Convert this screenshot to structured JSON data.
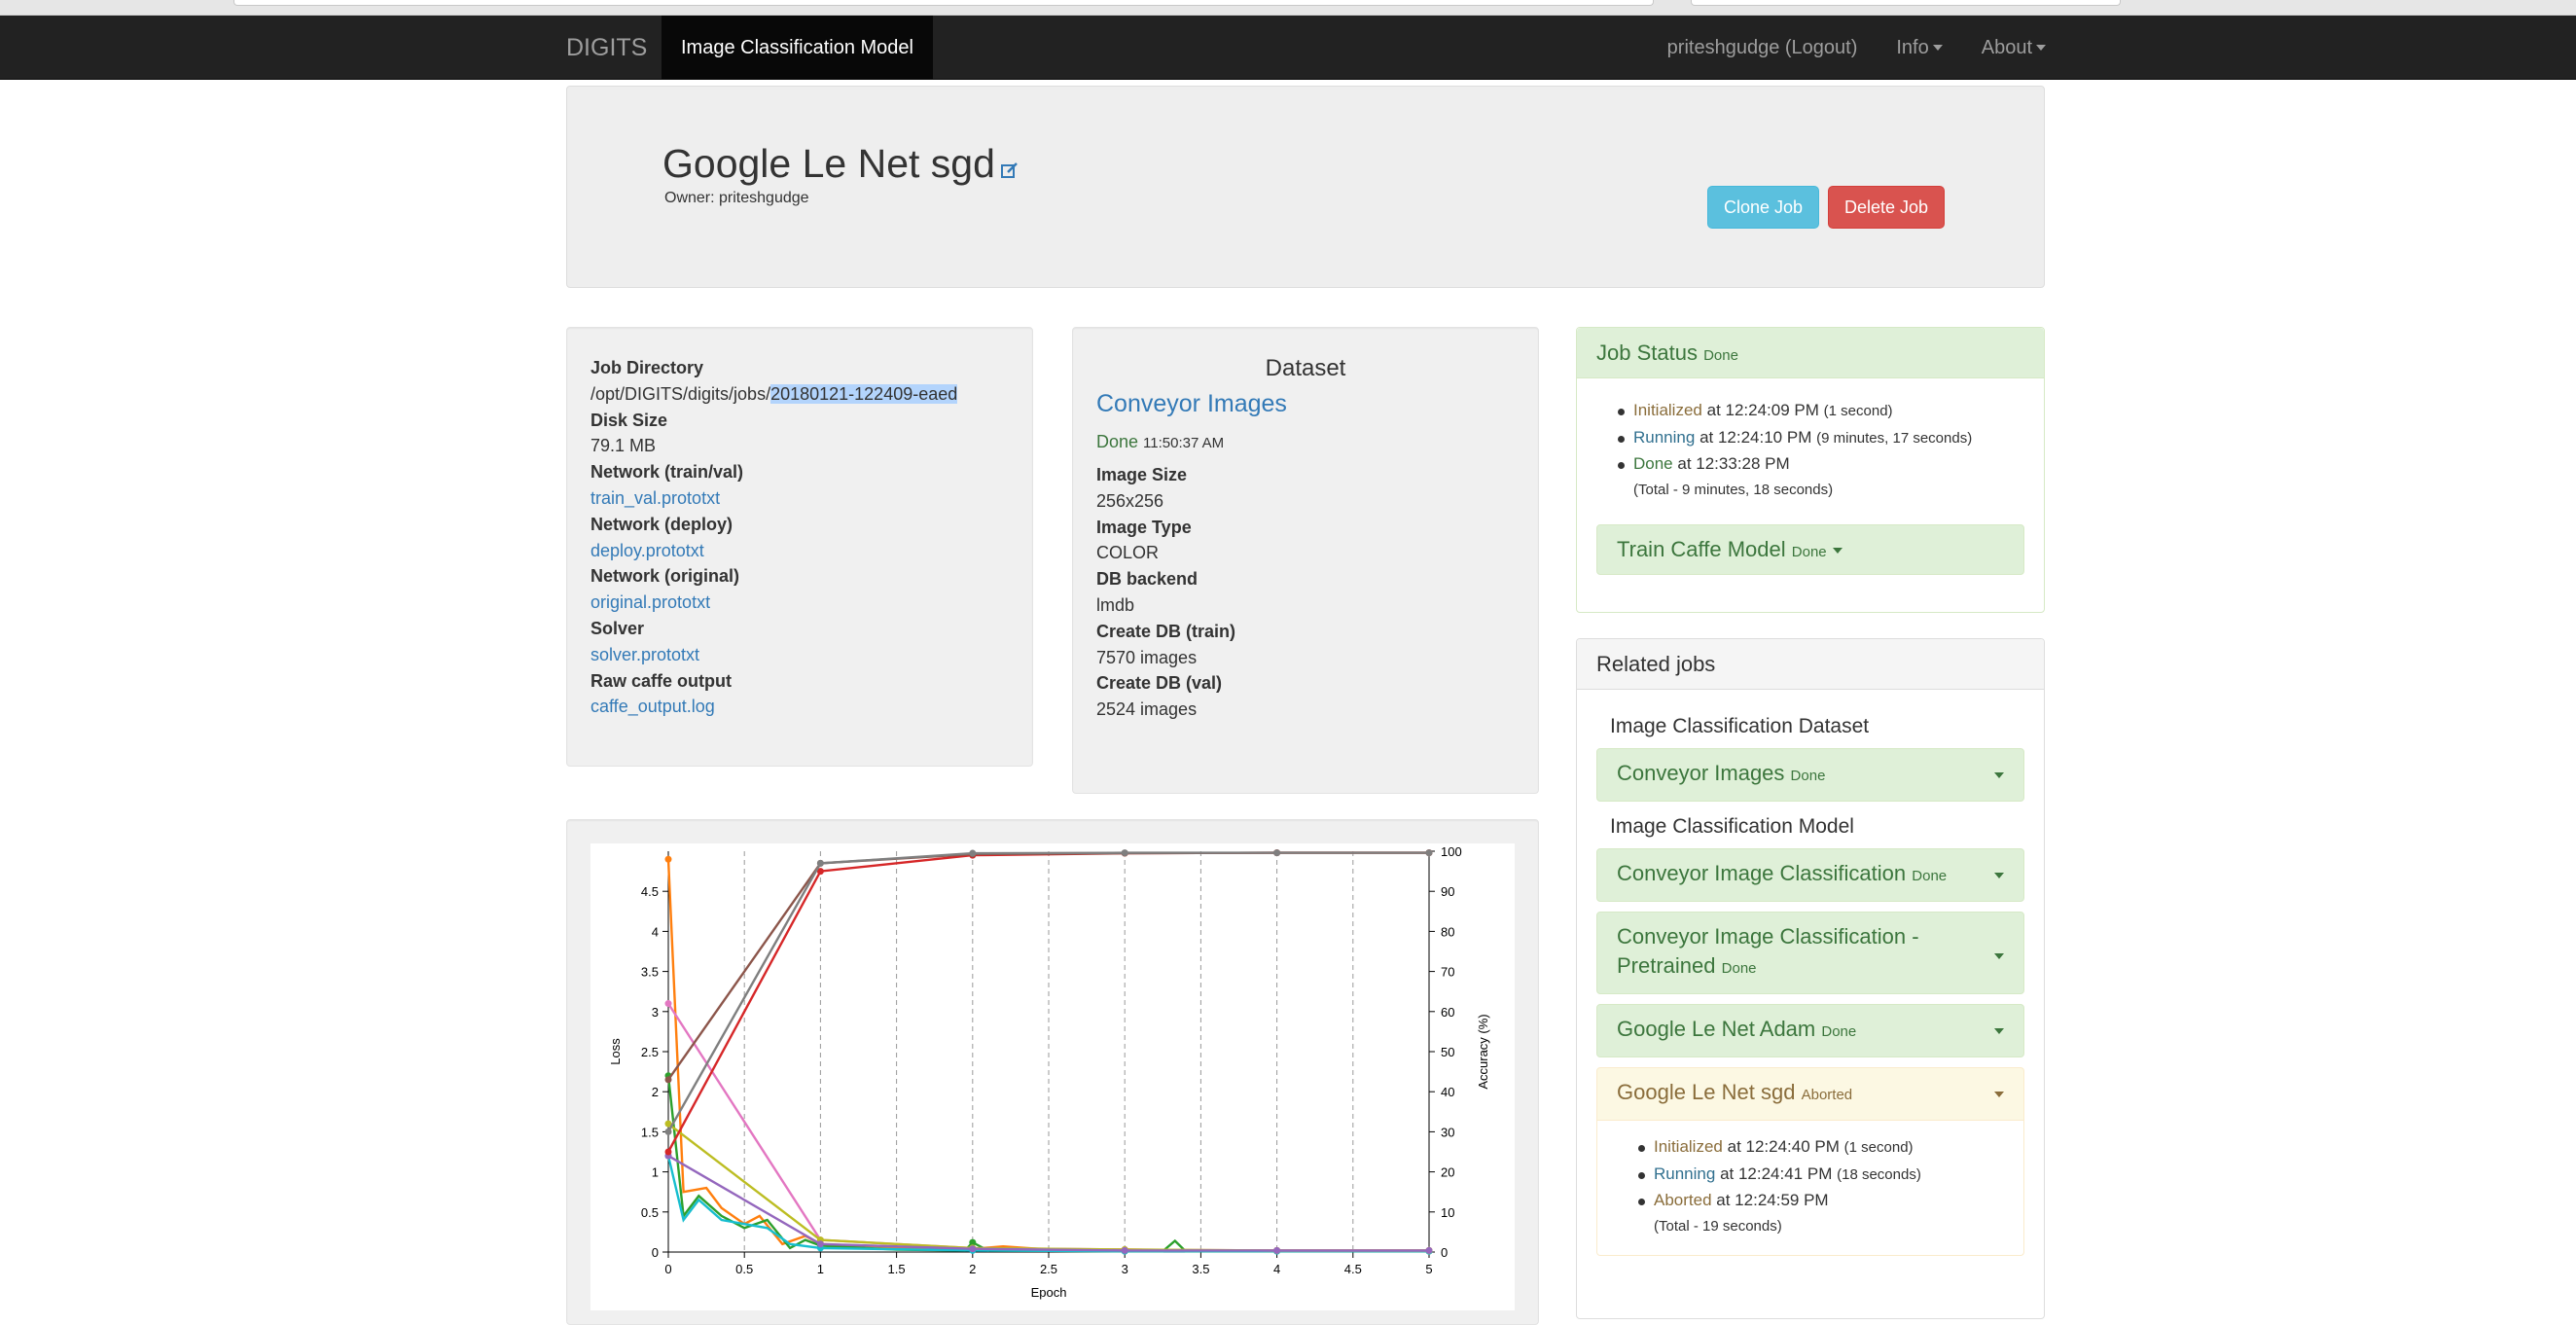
{
  "nav": {
    "brand": "DIGITS",
    "active": "Image Classification Model",
    "user": "priteshgudge (Logout)",
    "info": "Info",
    "about": "About"
  },
  "header": {
    "title": "Google Le Net sgd",
    "owner": "Owner: priteshgudge",
    "clone": "Clone Job",
    "delete": "Delete Job"
  },
  "info": {
    "job_dir_label": "Job Directory",
    "job_dir_prefix": "/opt/DIGITS/digits/jobs/",
    "job_dir_id": "20180121-122409-eaed",
    "disk_label": "Disk Size",
    "disk_value": "79.1 MB",
    "net_train_label": "Network (train/val)",
    "net_train_link": "train_val.prototxt",
    "net_deploy_label": "Network (deploy)",
    "net_deploy_link": "deploy.prototxt",
    "net_orig_label": "Network (original)",
    "net_orig_link": "original.prototxt",
    "solver_label": "Solver",
    "solver_link": "solver.prototxt",
    "raw_label": "Raw caffe output",
    "raw_link": "caffe_output.log"
  },
  "dataset": {
    "heading": "Dataset",
    "name": "Conveyor Images",
    "status": "Done",
    "status_time": "11:50:37 AM",
    "size_label": "Image Size",
    "size_value": "256x256",
    "type_label": "Image Type",
    "type_value": "COLOR",
    "backend_label": "DB backend",
    "backend_value": "lmdb",
    "train_label": "Create DB (train)",
    "train_value": "7570 images",
    "val_label": "Create DB (val)",
    "val_value": "2524 images"
  },
  "job_status": {
    "title": "Job Status",
    "state": "Done",
    "steps": [
      {
        "name": "Initialized",
        "time": "at 12:24:09 PM",
        "dur": "(1 second)"
      },
      {
        "name": "Running",
        "time": "at 12:24:10 PM",
        "dur": "(9 minutes, 17 seconds)"
      },
      {
        "name": "Done",
        "time": "at 12:33:28 PM",
        "dur": ""
      }
    ],
    "total": "(Total - 9 minutes, 18 seconds)",
    "task": "Train Caffe Model",
    "task_state": "Done"
  },
  "related": {
    "title": "Related jobs",
    "group1": "Image Classification Dataset",
    "group2": "Image Classification Model",
    "jobs": [
      {
        "name": "Conveyor Images",
        "state": "Done"
      },
      {
        "name": "Conveyor Image Classification",
        "state": "Done"
      },
      {
        "name": "Conveyor Image Classification - Pretrained",
        "state": "Done"
      },
      {
        "name": "Google Le Net Adam",
        "state": "Done"
      },
      {
        "name": "Google Le Net sgd",
        "state": "Aborted"
      }
    ],
    "detail": [
      {
        "name": "Initialized",
        "time": "at 12:24:40 PM",
        "dur": "(1 second)"
      },
      {
        "name": "Running",
        "time": "at 12:24:41 PM",
        "dur": "(18 seconds)"
      },
      {
        "name": "Aborted",
        "time": "at 12:24:59 PM",
        "dur": ""
      }
    ],
    "detail_total": "(Total - 19 seconds)"
  },
  "chart_data": {
    "type": "line",
    "xlabel": "Epoch",
    "ylabel": "Loss",
    "y2label": "Accuracy (%)",
    "xlim": [
      0,
      5
    ],
    "ylim": [
      0,
      5
    ],
    "y2lim": [
      0,
      100
    ],
    "xticks": [
      0,
      0.5,
      1,
      1.5,
      2,
      2.5,
      3,
      3.5,
      4,
      4.5,
      5
    ],
    "yticks": [
      0,
      0.5,
      1,
      1.5,
      2,
      2.5,
      3,
      3.5,
      4,
      4.5
    ],
    "y2ticks": [
      0,
      10,
      20,
      30,
      40,
      50,
      60,
      70,
      80,
      90,
      100
    ],
    "series": [
      {
        "axis": "y",
        "color": "#ff7f0e",
        "points": [
          [
            0,
            4.9
          ],
          [
            0.1,
            0.75
          ],
          [
            0.25,
            0.8
          ],
          [
            0.35,
            0.55
          ],
          [
            0.5,
            0.35
          ],
          [
            0.6,
            0.45
          ],
          [
            0.75,
            0.1
          ],
          [
            0.9,
            0.2
          ],
          [
            1,
            0.1
          ],
          [
            1.5,
            0.06
          ],
          [
            2,
            0.04
          ],
          [
            2.2,
            0.07
          ],
          [
            2.5,
            0.03
          ],
          [
            3,
            0.03
          ],
          [
            3.5,
            0.02
          ],
          [
            4,
            0.02
          ],
          [
            4.5,
            0.02
          ],
          [
            5,
            0.02
          ]
        ]
      },
      {
        "axis": "y",
        "color": "#2ca02c",
        "points": [
          [
            0,
            2.2
          ],
          [
            0.1,
            0.45
          ],
          [
            0.2,
            0.7
          ],
          [
            0.35,
            0.45
          ],
          [
            0.5,
            0.3
          ],
          [
            0.65,
            0.4
          ],
          [
            0.8,
            0.05
          ],
          [
            0.9,
            0.15
          ],
          [
            1,
            0.08
          ],
          [
            1.5,
            0.03
          ],
          [
            1.95,
            0.02
          ],
          [
            2,
            0.12
          ],
          [
            2.1,
            0.02
          ],
          [
            3,
            0.01
          ],
          [
            3.25,
            0.01
          ],
          [
            3.33,
            0.14
          ],
          [
            3.4,
            0.01
          ],
          [
            4,
            0.01
          ],
          [
            5,
            0.01
          ]
        ]
      },
      {
        "axis": "y",
        "color": "#17becf",
        "points": [
          [
            0,
            1.2
          ],
          [
            0.1,
            0.4
          ],
          [
            0.2,
            0.65
          ],
          [
            0.35,
            0.4
          ],
          [
            0.5,
            0.35
          ],
          [
            0.65,
            0.3
          ],
          [
            0.8,
            0.1
          ],
          [
            1,
            0.05
          ],
          [
            2,
            0.02
          ],
          [
            3,
            0.01
          ],
          [
            4,
            0.01
          ],
          [
            5,
            0.01
          ]
        ]
      },
      {
        "axis": "y",
        "color": "#e377c2",
        "points": [
          [
            0,
            3.1
          ],
          [
            1,
            0.15
          ],
          [
            2,
            0.05
          ],
          [
            3,
            0.03
          ],
          [
            4,
            0.02
          ],
          [
            5,
            0.02
          ]
        ]
      },
      {
        "axis": "y",
        "color": "#bcbd22",
        "points": [
          [
            0,
            1.6
          ],
          [
            1,
            0.15
          ],
          [
            2,
            0.05
          ],
          [
            3,
            0.03
          ],
          [
            4,
            0.02
          ],
          [
            5,
            0.02
          ]
        ]
      },
      {
        "axis": "y",
        "color": "#9467bd",
        "points": [
          [
            0,
            1.2
          ],
          [
            1,
            0.1
          ],
          [
            2,
            0.04
          ],
          [
            3,
            0.02
          ],
          [
            4,
            0.02
          ],
          [
            5,
            0.02
          ]
        ]
      },
      {
        "axis": "y2",
        "color": "#d62728",
        "points": [
          [
            0,
            25
          ],
          [
            1,
            95
          ],
          [
            2,
            99
          ],
          [
            3,
            99.5
          ],
          [
            4,
            99.6
          ],
          [
            5,
            99.6
          ]
        ]
      },
      {
        "axis": "y2",
        "color": "#8c564b",
        "points": [
          [
            0,
            43
          ],
          [
            1,
            97
          ],
          [
            2,
            99.3
          ],
          [
            3,
            99.5
          ],
          [
            4,
            99.6
          ],
          [
            5,
            99.6
          ]
        ]
      },
      {
        "axis": "y2",
        "color": "#7f7f7f",
        "points": [
          [
            0,
            30
          ],
          [
            1,
            97
          ],
          [
            2,
            99.5
          ],
          [
            3,
            99.6
          ],
          [
            4,
            99.6
          ],
          [
            5,
            99.6
          ]
        ]
      }
    ]
  }
}
